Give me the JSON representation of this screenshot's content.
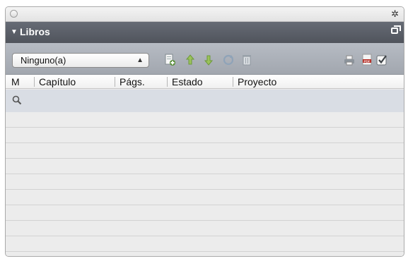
{
  "window": {
    "close_control": "close-circle-icon",
    "settings_icon": "gear-icon"
  },
  "section": {
    "title": "Libros",
    "disclosure_icon": "disclosure-triangle-icon",
    "popout_icon": "popout-icon"
  },
  "toolbar": {
    "selector_value": "Ninguno(a)",
    "tools_left": [
      "add-chapter-icon",
      "move-up-icon",
      "move-down-icon",
      "synchronize-icon",
      "delete-icon"
    ],
    "tools_right": [
      "print-icon",
      "pdf-icon",
      "check-icon"
    ],
    "colors": {
      "add": "#5a8f3a",
      "arrow": "#9bc25b",
      "sync": "#8fa3b8",
      "pdf": "#b42a22"
    }
  },
  "table": {
    "columns": [
      "M",
      "Capítulo",
      "Págs.",
      "Estado",
      "Proyecto"
    ],
    "search_icon": "search-icon",
    "rows": []
  }
}
